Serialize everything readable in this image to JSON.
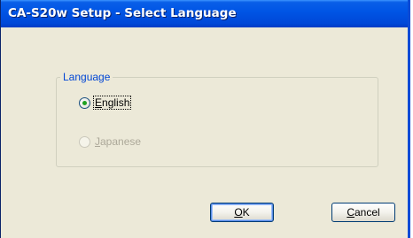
{
  "window": {
    "title": "CA-S20w Setup - Select Language"
  },
  "language_group": {
    "legend": "Language",
    "options": [
      {
        "accel": "E",
        "rest": "nglish",
        "selected": true,
        "enabled": true
      },
      {
        "accel": "J",
        "rest": "apanese",
        "selected": false,
        "enabled": false
      }
    ]
  },
  "buttons": {
    "ok": {
      "accel": "O",
      "rest": "K"
    },
    "cancel": {
      "accel": "C",
      "rest": "ancel"
    }
  },
  "colors": {
    "title_bar": "#0055e5",
    "dialog_bg": "#ece9d8",
    "legend_text": "#0046d5",
    "radio_dot": "#21a121"
  }
}
